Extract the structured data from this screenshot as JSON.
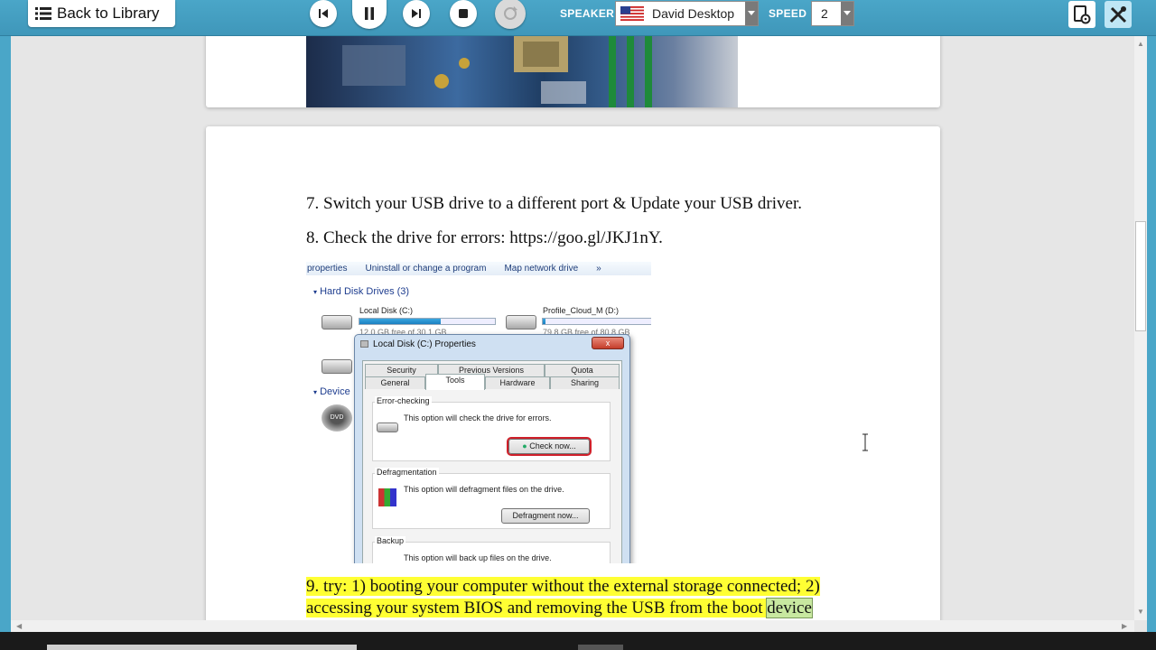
{
  "toolbar": {
    "back_label": "Back to Library",
    "speaker_label": "SPEAKER",
    "speaker_value": "David Desktop",
    "speed_label": "SPEED",
    "speed_value": "2"
  },
  "content": {
    "step7": "7. Switch your USB drive to a different port & Update your USB driver.",
    "step8": "8. Check the drive for errors: https://goo.gl/JKJ1nY.",
    "step9_line1": "9. try: 1) booting your computer without the external storage connected; 2)",
    "step9_line2_pre": "accessing your system BIOS and removing the USB from the boot",
    "step9_line2_word": "device"
  },
  "screenshot": {
    "commands": [
      "properties",
      "Uninstall or change a program",
      "Map network drive",
      "»"
    ],
    "group_hdd": "Hard Disk Drives (3)",
    "group_devices": "Device",
    "drive_c": "Local Disk (C:)",
    "drive_c_free": "12.0 GB free of 30.1 GB",
    "drive_c_used": 0.6,
    "drive_d": "Profile_Cloud_M (D:)",
    "drive_d_free": "79.8 GB free of 80.8 GB",
    "drive_d_used": 0.02,
    "dvd_label": "DVD",
    "dialog_title": "Local Disk (C:) Properties",
    "dialog_close": "x",
    "tabs_row1": [
      "Security",
      "Previous Versions",
      "Quota"
    ],
    "tabs_row2": [
      "General",
      "Tools",
      "Hardware",
      "Sharing"
    ],
    "error_checking_header": "Error-checking",
    "error_checking_text": "This option will check the drive for errors.",
    "check_now": "Check now...",
    "defrag_header": "Defragmentation",
    "defrag_text": "This option will defragment files on the drive.",
    "defrag_now": "Defragment now...",
    "backup_header": "Backup",
    "backup_text": "This option will back up files on the drive."
  },
  "colors": {
    "toolbar": "#4aa6c8",
    "highlight": "#ffff33",
    "check_now_outline": "#d0202a"
  }
}
